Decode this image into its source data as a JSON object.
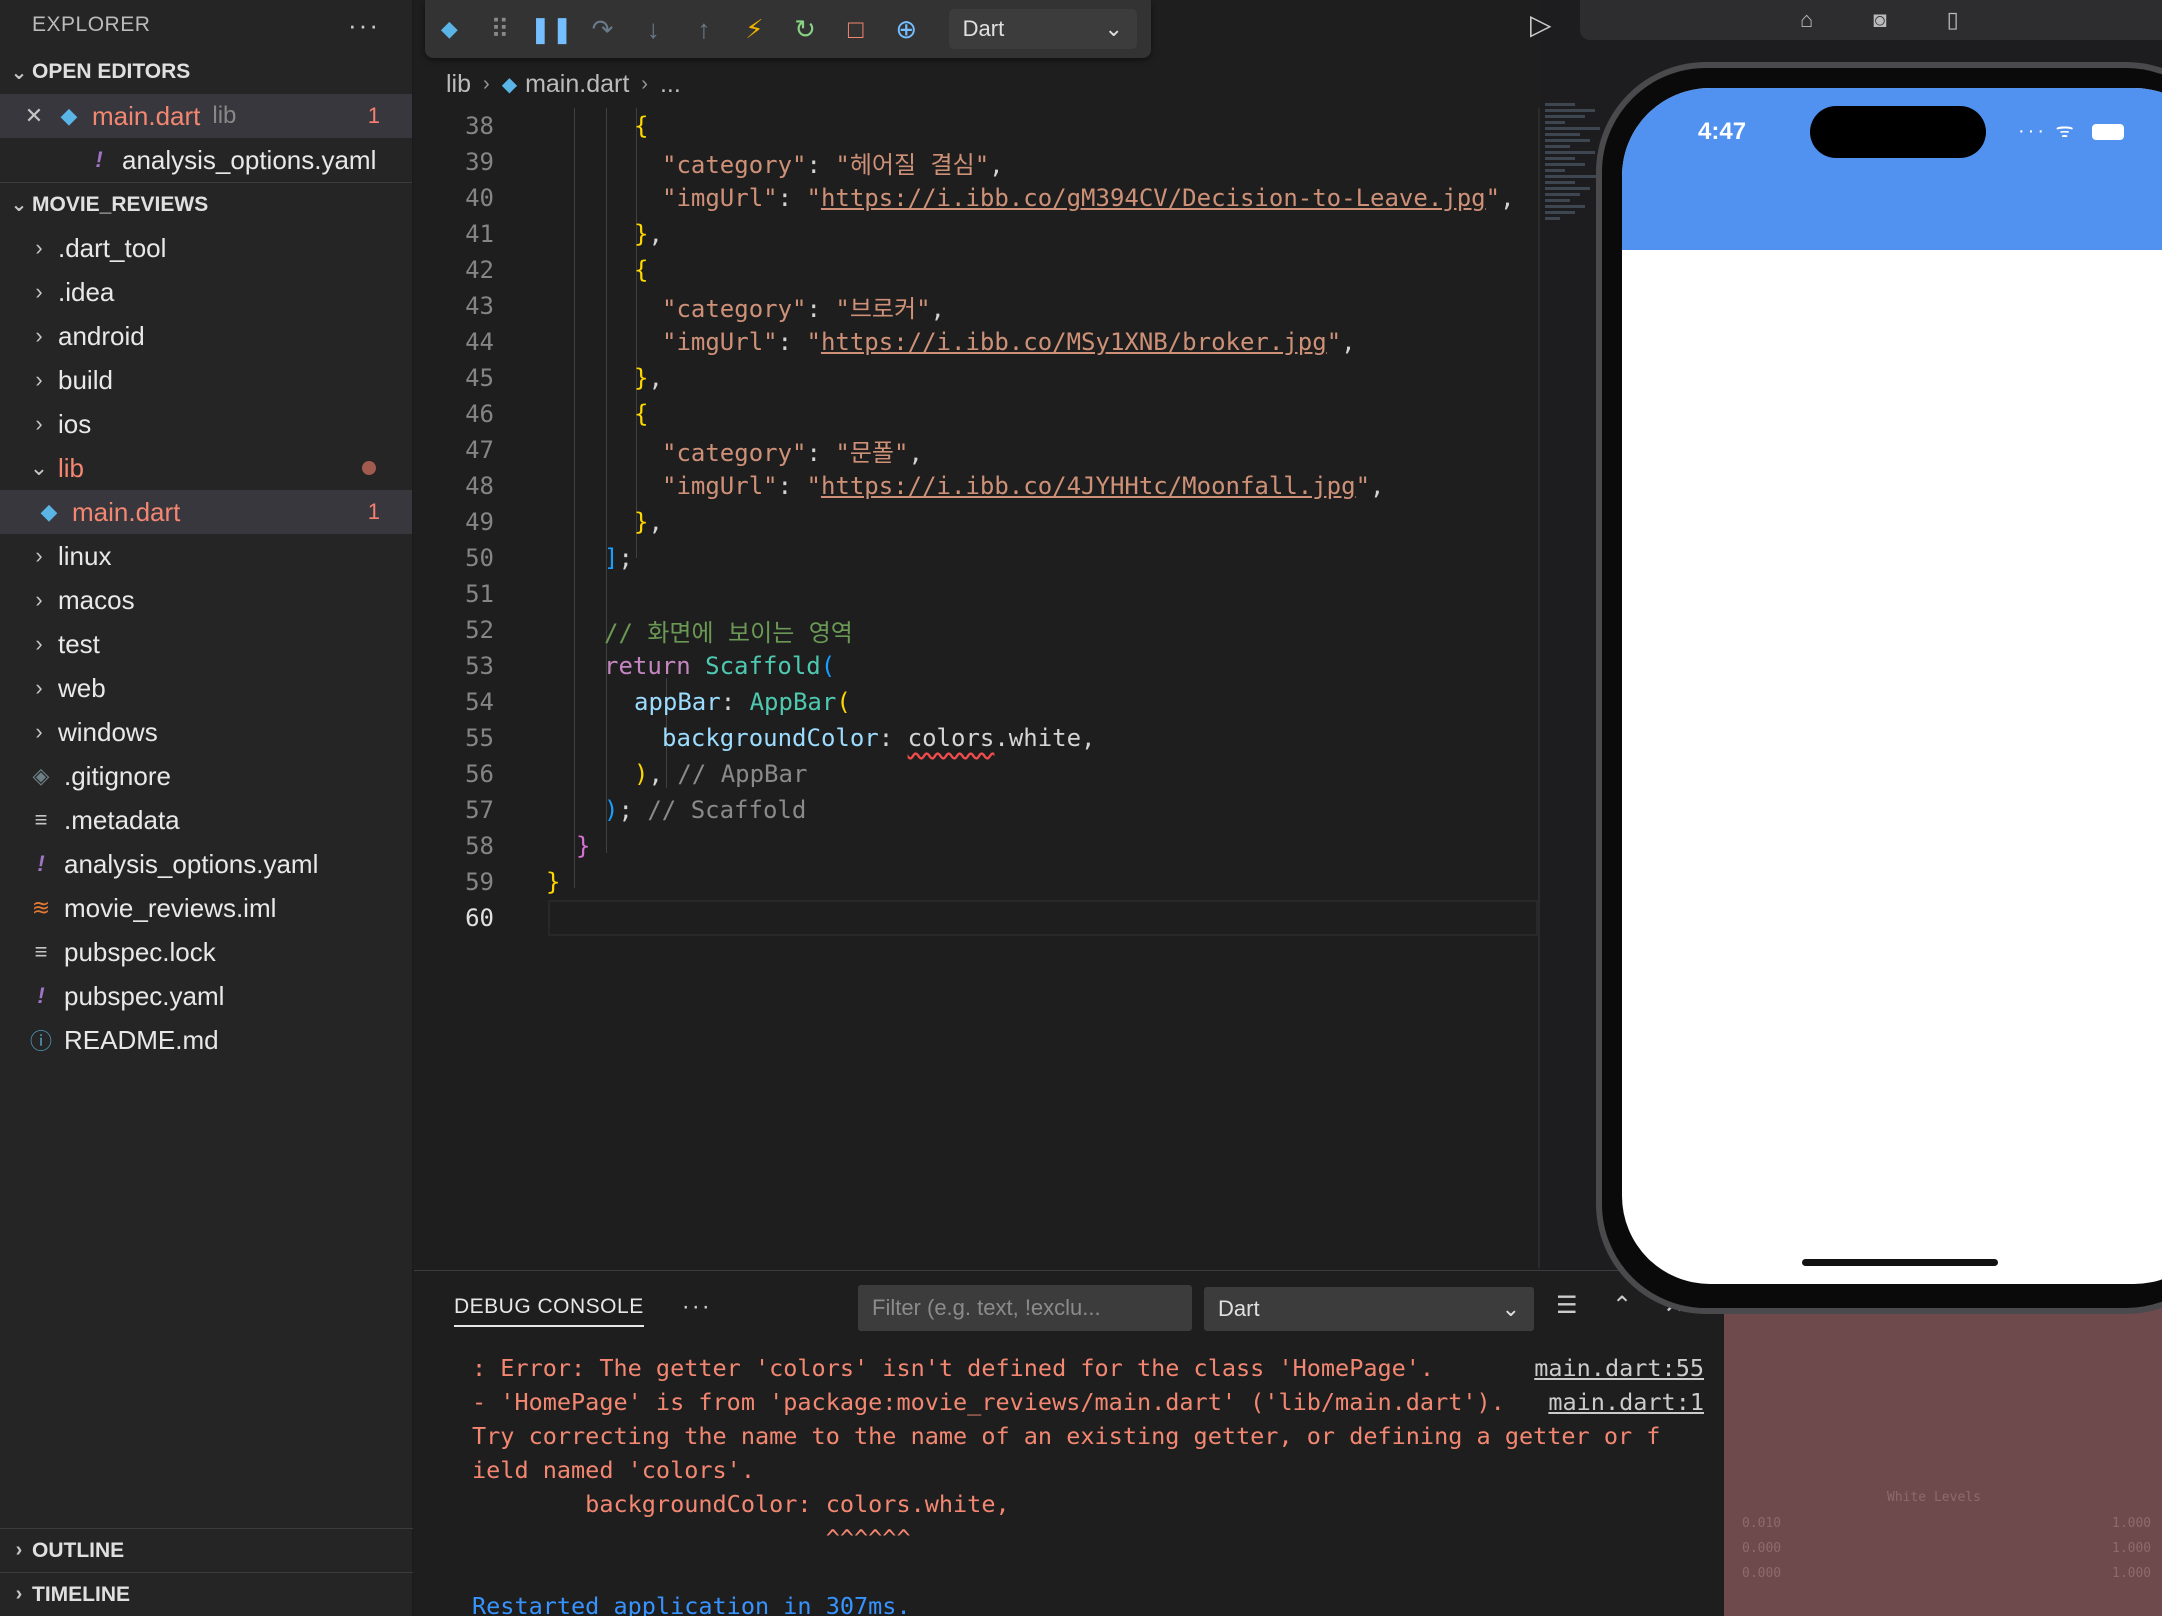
{
  "explorer": {
    "title": "EXPLORER",
    "more": "···",
    "open_editors_title": "OPEN EDITORS",
    "open_editors": [
      {
        "close": "✕",
        "name": "main.dart",
        "hint": "lib",
        "badge": "1"
      },
      {
        "name": "analysis_options.yaml"
      }
    ],
    "project_title": "MOVIE_REVIEWS",
    "tree": [
      {
        "name": ".dart_tool",
        "type": "folder"
      },
      {
        "name": ".idea",
        "type": "folder"
      },
      {
        "name": "android",
        "type": "folder"
      },
      {
        "name": "build",
        "type": "folder"
      },
      {
        "name": "ios",
        "type": "folder"
      },
      {
        "name": "lib",
        "type": "folder-open"
      },
      {
        "name": "main.dart",
        "type": "dart",
        "badge": "1"
      },
      {
        "name": "linux",
        "type": "folder"
      },
      {
        "name": "macos",
        "type": "folder"
      },
      {
        "name": "test",
        "type": "folder"
      },
      {
        "name": "web",
        "type": "folder"
      },
      {
        "name": "windows",
        "type": "folder"
      },
      {
        "name": ".gitignore",
        "type": "git"
      },
      {
        "name": ".metadata",
        "type": "text"
      },
      {
        "name": "analysis_options.yaml",
        "type": "yaml"
      },
      {
        "name": "movie_reviews.iml",
        "type": "iml"
      },
      {
        "name": "pubspec.lock",
        "type": "text"
      },
      {
        "name": "pubspec.yaml",
        "type": "yaml"
      },
      {
        "name": "README.md",
        "type": "info"
      }
    ],
    "outline_title": "OUTLINE",
    "timeline_title": "TIMELINE"
  },
  "debug_toolbar": {
    "config": "Dart"
  },
  "breadcrumb": {
    "folder": "lib",
    "file": "main.dart",
    "more": "..."
  },
  "editor": {
    "line_numbers": [
      "38",
      "39",
      "40",
      "41",
      "42",
      "43",
      "44",
      "45",
      "46",
      "47",
      "48",
      "49",
      "50",
      "51",
      "52",
      "53",
      "54",
      "55",
      "56",
      "57",
      "58",
      "59",
      "60"
    ],
    "current_line": "60",
    "movies": [
      {
        "key_category": "\"category\"",
        "category": "\"헤어질 결심\"",
        "key_img": "\"imgUrl\"",
        "url": "https://i.ibb.co/gM394CV/Decision-to-Leave.jpg"
      },
      {
        "key_category": "\"category\"",
        "category": "\"브로커\"",
        "key_img": "\"imgUrl\"",
        "url": "https://i.ibb.co/MSy1XNB/broker.jpg"
      },
      {
        "key_category": "\"category\"",
        "category": "\"문폴\"",
        "key_img": "\"imgUrl\"",
        "url": "https://i.ibb.co/4JYHHtc/Moonfall.jpg"
      }
    ],
    "comment": "// 화면에 보이는 영역",
    "return_kw": "return",
    "scaffold": "Scaffold",
    "appbar_prop": "appBar",
    "appbar_cls": "AppBar",
    "bg_prop": "backgroundColor",
    "colors_ident": "colors",
    "white_member": ".white,",
    "appbar_comment": "// AppBar",
    "scaffold_comment": "// Scaffold"
  },
  "panel": {
    "tab": "DEBUG CONSOLE",
    "more": "···",
    "filter_placeholder": "Filter (e.g. text, !exclu...",
    "select_value": "Dart",
    "lines": [
      {
        "text": ": Error: The getter 'colors' isn't defined for the class 'HomePage'.",
        "src": "main.dart:55"
      },
      {
        "text": "- 'HomePage' is from 'package:movie_reviews/main.dart' ('lib/main.dart').",
        "src": "main.dart:1"
      },
      {
        "text": "Try correcting the name to the name of an existing getter, or defining a getter or f"
      },
      {
        "text": "ield named 'colors'."
      },
      {
        "text": "        backgroundColor: colors.white,"
      },
      {
        "text": "                         ^^^^^^"
      },
      {
        "text": ""
      },
      {
        "text": "Restarted application in 307ms.",
        "info": true
      }
    ]
  },
  "simulator": {
    "time": "4:47",
    "appbar_color": "#5191f0"
  },
  "colors": {
    "accent_error": "#f48771",
    "string": "#ce9178",
    "comment": "#6a9955"
  }
}
